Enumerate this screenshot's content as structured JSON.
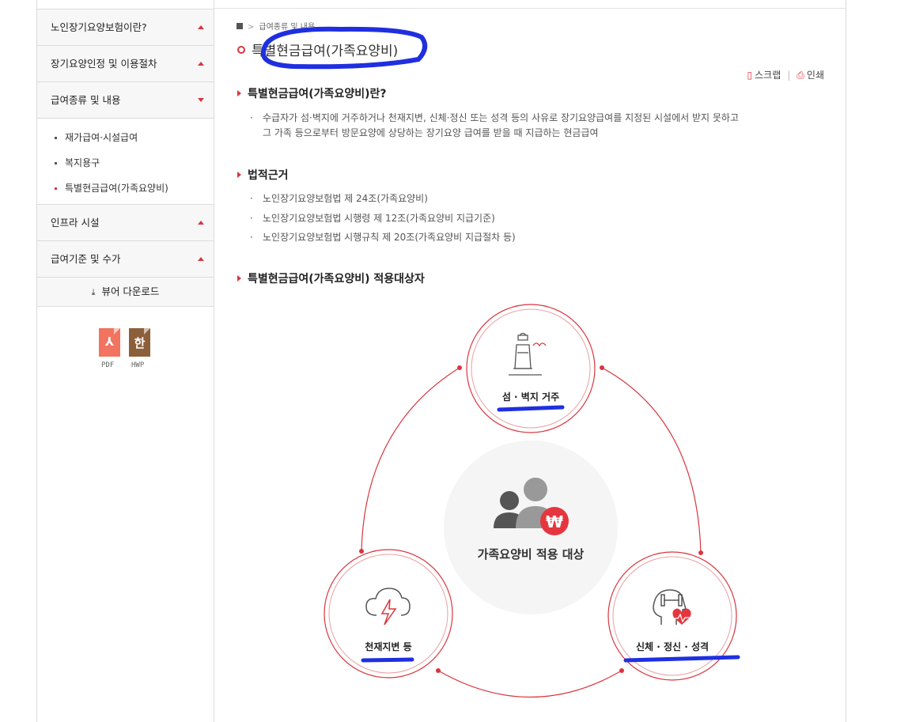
{
  "sidebar": {
    "menu": [
      {
        "label": "노인장기요양보험이란?",
        "state": "collapsed"
      },
      {
        "label": "장기요양인정 및 이용절차",
        "state": "collapsed"
      },
      {
        "label": "급여종류 및 내용",
        "state": "expanded"
      }
    ],
    "submenu": [
      {
        "label": "재가급여·시설급여"
      },
      {
        "label": "복지용구"
      },
      {
        "label": "특별현금급여(가족요양비)",
        "active": true
      }
    ],
    "menu_after": [
      {
        "label": "인프라 시설"
      },
      {
        "label": "급여기준 및 수가"
      }
    ],
    "viewer_download": "뷰어 다운로드",
    "files": [
      {
        "glyph": "⅄",
        "label": "PDF"
      },
      {
        "glyph": "한",
        "label": "HWP"
      }
    ]
  },
  "breadcrumb": "급여종류 및 내용",
  "page": {
    "title": "특별현금급여(가족요양비)",
    "tools": {
      "scrap": "스크랩",
      "print": "인쇄"
    }
  },
  "sections": {
    "definition": {
      "title": "특별현금급여(가족요양비)란?",
      "line1": "수급자가 섬·벽지에 거주하거나 천재지변, 신체·정신 또는 성격 등의 사유로 장기요양급여를 지정된 시설에서 받지 못하고",
      "line2": "그 가족 등으로부터 방문요양에 상당하는 장기요양 급여를 받을 때 지급하는 현금급여"
    },
    "legal": {
      "title": "법적근거",
      "items": [
        "노인장기요양보험법 제 24조(가족요양비)",
        "노인장기요양보험법 시행령 제 12조(가족요양비 지급기준)",
        "노인장기요양보험법 시행규칙 제 20조(가족요양비 지급절차 등)"
      ]
    },
    "target": {
      "title": "특별현금급여(가족요양비) 적용대상자"
    }
  },
  "diagram": {
    "center": "가족요양비 적용 대상",
    "top": "섬 · 벽지 거주",
    "left": "천재지변 등",
    "right": "신체 · 정신 · 성격",
    "currency": "₩",
    "accent": "#d9363e",
    "marker_color": "#1f2fe0"
  }
}
